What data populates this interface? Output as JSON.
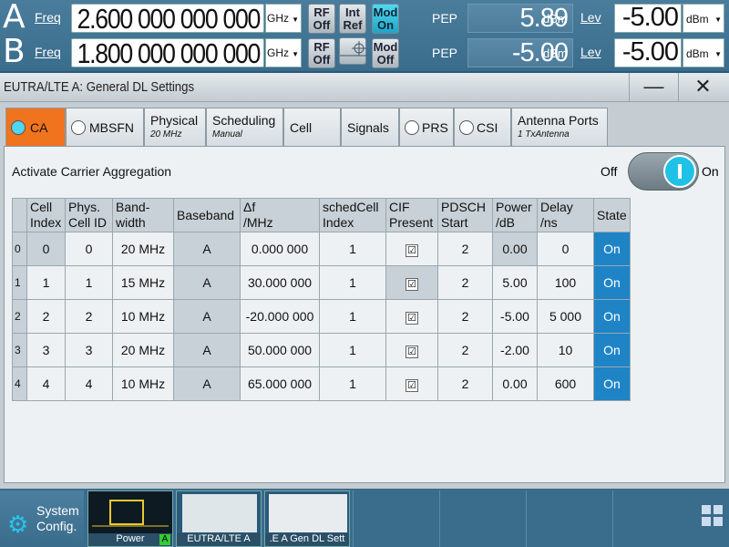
{
  "header": {
    "rows": [
      {
        "path": "A",
        "freq_label": "Freq",
        "freq_value": "2.600 000 000 000",
        "freq_unit": "GHz",
        "rf": "RF\nOff",
        "mod": "Mod\nOn",
        "pep_label": "PEP",
        "pep_value": "5.89",
        "pep_unit": "dBm",
        "lev_label": "Lev",
        "lev_value": "-5.00",
        "lev_unit": "dBm"
      },
      {
        "path": "B",
        "freq_label": "Freq",
        "freq_value": "1.800 000 000 000",
        "freq_unit": "GHz",
        "rf": "RF\nOff",
        "mod": "Mod\nOff",
        "pep_label": "PEP",
        "pep_value": "-5.00",
        "pep_unit": "dBm",
        "lev_label": "Lev",
        "lev_value": "-5.00",
        "lev_unit": "dBm"
      }
    ],
    "int_ref": "Int\nRef"
  },
  "window": {
    "title": "EUTRA/LTE A: General DL Settings",
    "minimize": "—",
    "close": "✕"
  },
  "tabs": [
    {
      "label": "CA",
      "radio": true,
      "active": true
    },
    {
      "label": "MBSFN",
      "radio": true
    },
    {
      "label": "Physical",
      "sub": "20 MHz"
    },
    {
      "label": "Scheduling",
      "sub": "Manual"
    },
    {
      "label": "Cell"
    },
    {
      "label": "Signals"
    },
    {
      "label": "PRS",
      "radio": true
    },
    {
      "label": "CSI",
      "radio": true
    },
    {
      "label": "Antenna Ports",
      "sub": "1 TxAntenna"
    }
  ],
  "ca": {
    "activate_label": "Activate Carrier Aggregation",
    "off_label": "Off",
    "on_label": "On",
    "columns": [
      "Cell\nIndex",
      "Phys.\nCell ID",
      "Band-\nwidth",
      "Baseband",
      "Δf\n/MHz",
      "schedCell\nIndex",
      "CIF\nPresent",
      "PDSCH\nStart",
      "Power\n/dB",
      "Delay\n/ns",
      "State"
    ],
    "rows": [
      {
        "n": "0",
        "cell": "0",
        "phys": "0",
        "bw": "20 MHz",
        "bb": "A",
        "df": "0.000 000",
        "sched": "1",
        "cif": "☑",
        "pdsch": "2",
        "power": "0.00",
        "delay": "0",
        "state": "On"
      },
      {
        "n": "1",
        "cell": "1",
        "phys": "1",
        "bw": "15 MHz",
        "bb": "A",
        "df": "30.000 000",
        "sched": "1",
        "cif": "☑",
        "pdsch": "2",
        "power": "5.00",
        "delay": "100",
        "state": "On"
      },
      {
        "n": "2",
        "cell": "2",
        "phys": "2",
        "bw": "10 MHz",
        "bb": "A",
        "df": "-20.000 000",
        "sched": "1",
        "cif": "☑",
        "pdsch": "2",
        "power": "-5.00",
        "delay": "5 000",
        "state": "On"
      },
      {
        "n": "3",
        "cell": "3",
        "phys": "3",
        "bw": "20 MHz",
        "bb": "A",
        "df": "50.000 000",
        "sched": "1",
        "cif": "☑",
        "pdsch": "2",
        "power": "-2.00",
        "delay": "10",
        "state": "On"
      },
      {
        "n": "4",
        "cell": "4",
        "phys": "4",
        "bw": "10 MHz",
        "bb": "A",
        "df": "65.000 000",
        "sched": "1",
        "cif": "☑",
        "pdsch": "2",
        "power": "0.00",
        "delay": "600",
        "state": "On"
      }
    ]
  },
  "taskbar": {
    "system": "System\nConfig.",
    "thumbs": [
      "Power",
      "EUTRA/LTE A",
      ".E A Gen DL Sett"
    ],
    "power_badge": "A"
  }
}
